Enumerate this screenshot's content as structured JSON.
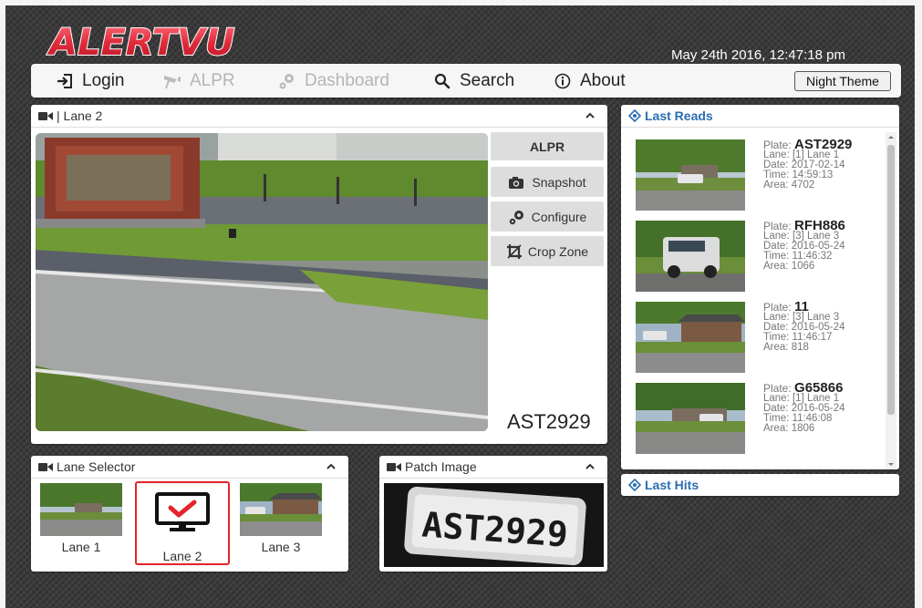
{
  "app": {
    "logo_text": "ALERTVU",
    "clock": "May 24th 2016, 12:47:18 pm"
  },
  "nav": {
    "items": [
      {
        "label": "Login",
        "icon": "login-icon",
        "disabled": false
      },
      {
        "label": "ALPR",
        "icon": "alpr-camera-icon",
        "disabled": true
      },
      {
        "label": "Dashboard",
        "icon": "gears-icon",
        "disabled": true
      },
      {
        "label": "Search",
        "icon": "search-icon",
        "disabled": false
      },
      {
        "label": "About",
        "icon": "info-icon",
        "disabled": false
      }
    ],
    "night_theme": "Night Theme"
  },
  "lane_panel": {
    "title": "| Lane 2",
    "buttons": {
      "alpr": "ALPR",
      "snapshot": "Snapshot",
      "configure": "Configure",
      "crop_zone": "Crop Zone"
    },
    "plate": "AST2929"
  },
  "last_reads": {
    "title": "Last Reads",
    "labels": {
      "plate": "Plate:",
      "lane": "Lane:",
      "date": "Date:",
      "time": "Time:",
      "area": "Area:"
    },
    "items": [
      {
        "plate": "AST2929",
        "lane": "[1] Lane 1",
        "date": "2017-02-14",
        "time": "14:59:13",
        "area": "4702"
      },
      {
        "plate": "RFH886",
        "lane": "[3] Lane 3",
        "date": "2016-05-24",
        "time": "11:46:32",
        "area": "1066"
      },
      {
        "plate": "11",
        "lane": "[3] Lane 3",
        "date": "2016-05-24",
        "time": "11:46:17",
        "area": "818"
      },
      {
        "plate": "G65866",
        "lane": "[1] Lane 1",
        "date": "2016-05-24",
        "time": "11:46:08",
        "area": "1806"
      }
    ]
  },
  "last_hits": {
    "title": "Last Hits"
  },
  "lane_selector": {
    "title": "Lane Selector",
    "lanes": [
      {
        "label": "Lane 1",
        "selected": false
      },
      {
        "label": "Lane 2",
        "selected": true
      },
      {
        "label": "Lane 3",
        "selected": false
      }
    ]
  },
  "patch": {
    "title": "Patch Image",
    "plate_text": "AST2929"
  },
  "colors": {
    "accent_link": "#2a6db0",
    "logo_red": "#e02b3c",
    "selected_border": "#e3242b",
    "check_red": "#e3242b"
  }
}
